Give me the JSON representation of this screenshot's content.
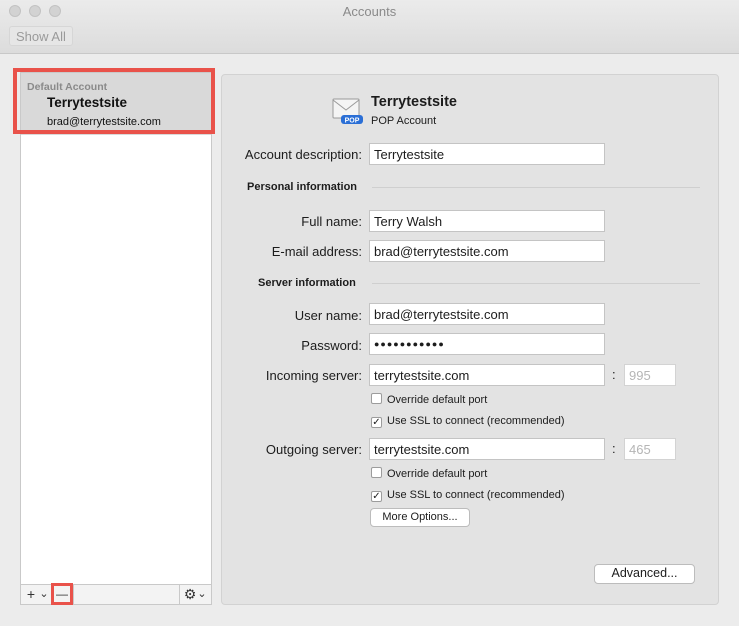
{
  "window": {
    "title": "Accounts",
    "show_all": "Show All"
  },
  "sidebar": {
    "account": {
      "header": "Default Account",
      "name": "Terrytestsite",
      "email": "brad@terrytestsite.com"
    },
    "footer": {
      "add": "+",
      "add_menu": "⌄",
      "remove": "—",
      "gear": "⚙",
      "gear_menu": "⌄"
    }
  },
  "panel": {
    "account_name": "Terrytestsite",
    "account_type": "POP Account",
    "icon_badge": "POP",
    "account_description": {
      "label": "Account description:",
      "value": "Terrytestsite"
    },
    "personal_section": "Personal information",
    "full_name": {
      "label": "Full name:",
      "value": "Terry Walsh"
    },
    "email_address": {
      "label": "E-mail address:",
      "value": "brad@terrytestsite.com"
    },
    "server_section": "Server information",
    "user_name": {
      "label": "User name:",
      "value": "brad@terrytestsite.com"
    },
    "password": {
      "label": "Password:",
      "value": "●●●●●●●●●●●"
    },
    "incoming": {
      "label": "Incoming server:",
      "value": "terrytestsite.com",
      "port": "995",
      "override_label": "Override default port",
      "override_checked": false,
      "ssl_label": "Use SSL to connect (recommended)",
      "ssl_checked": true
    },
    "outgoing": {
      "label": "Outgoing server:",
      "value": "terrytestsite.com",
      "port": "465",
      "override_label": "Override default port",
      "override_checked": false,
      "ssl_label": "Use SSL to connect (recommended)",
      "ssl_checked": true
    },
    "more_options": "More Options...",
    "advanced": "Advanced..."
  },
  "colors": {
    "highlight": "#e9524a",
    "selection": "#d9d9d9",
    "panel_bg": "#e3e3e3"
  }
}
